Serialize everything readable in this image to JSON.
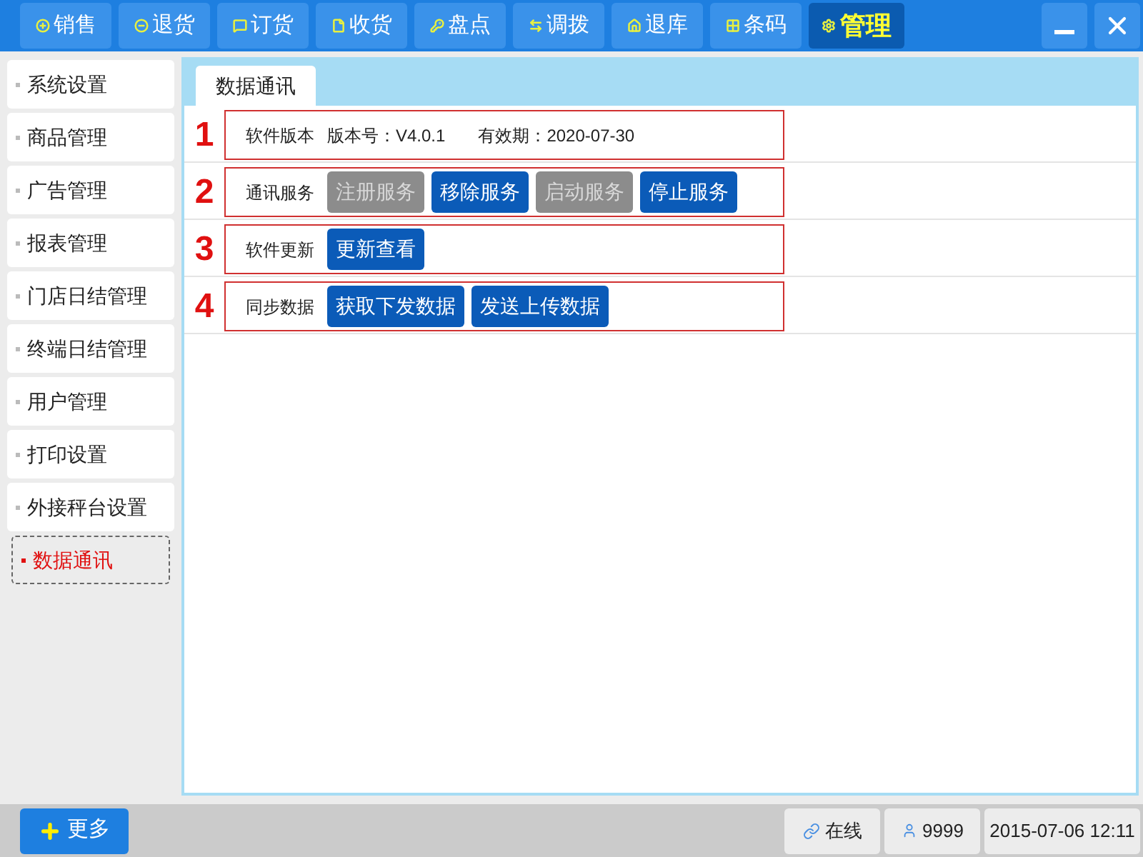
{
  "top_tabs": [
    {
      "label": "销售",
      "selected": false
    },
    {
      "label": "退货",
      "selected": false
    },
    {
      "label": "订货",
      "selected": false
    },
    {
      "label": "收货",
      "selected": false
    },
    {
      "label": "盘点",
      "selected": false
    },
    {
      "label": "调拨",
      "selected": false
    },
    {
      "label": "退库",
      "selected": false
    },
    {
      "label": "条码",
      "selected": false
    },
    {
      "label": "管理",
      "selected": true
    }
  ],
  "sidebar": {
    "items": [
      {
        "label": "系统设置",
        "selected": false
      },
      {
        "label": "商品管理",
        "selected": false
      },
      {
        "label": "广告管理",
        "selected": false
      },
      {
        "label": "报表管理",
        "selected": false
      },
      {
        "label": "门店日结管理",
        "selected": false
      },
      {
        "label": "终端日结管理",
        "selected": false
      },
      {
        "label": "用户管理",
        "selected": false
      },
      {
        "label": "打印设置",
        "selected": false
      },
      {
        "label": "外接秤台设置",
        "selected": false
      },
      {
        "label": "数据通讯",
        "selected": true
      }
    ]
  },
  "content_tab": "数据通讯",
  "sections": [
    {
      "number": "1",
      "label": "软件版本",
      "texts": [
        "版本号：V4.0.1",
        "有效期：2020-07-30"
      ]
    },
    {
      "number": "2",
      "label": "通讯服务",
      "buttons": [
        {
          "label": "注册服务",
          "disabled": true
        },
        {
          "label": "移除服务",
          "disabled": false
        },
        {
          "label": "启动服务",
          "disabled": true
        },
        {
          "label": "停止服务",
          "disabled": false
        }
      ]
    },
    {
      "number": "3",
      "label": "软件更新",
      "buttons": [
        {
          "label": "更新查看",
          "disabled": false
        }
      ]
    },
    {
      "number": "4",
      "label": "同步数据",
      "buttons": [
        {
          "label": "获取下发数据",
          "disabled": false
        },
        {
          "label": "发送上传数据",
          "disabled": false
        }
      ]
    }
  ],
  "status_bar": {
    "more_button": "更多",
    "connection": "在线",
    "user": "9999",
    "datetime": "2015-07-06 12:11"
  }
}
